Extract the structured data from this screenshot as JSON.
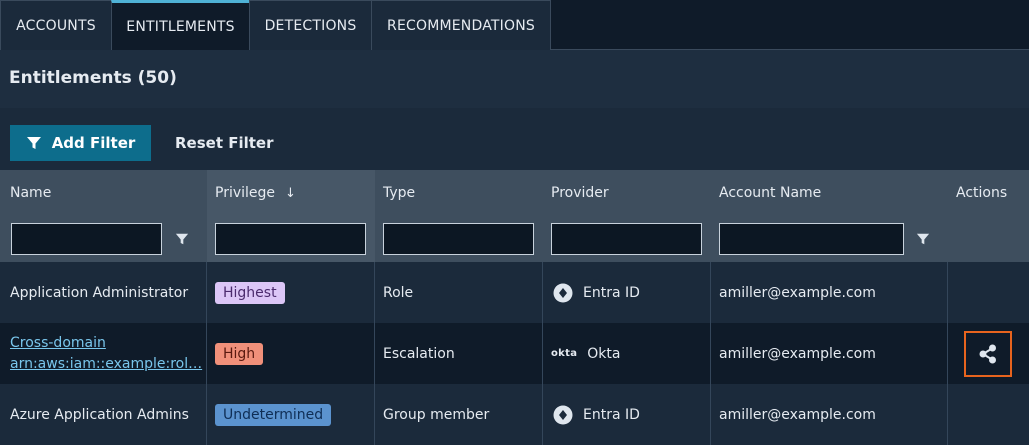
{
  "tabs": [
    {
      "label": "ACCOUNTS",
      "active": false
    },
    {
      "label": "ENTITLEMENTS",
      "active": true
    },
    {
      "label": "DETECTIONS",
      "active": false
    },
    {
      "label": "RECOMMENDATIONS",
      "active": false
    }
  ],
  "page": {
    "title": "Entitlements (50)"
  },
  "filters": {
    "add_label": "Add Filter",
    "reset_label": "Reset Filter"
  },
  "table": {
    "columns": [
      "Name",
      "Privilege",
      "Type",
      "Provider",
      "Account Name",
      "Actions"
    ],
    "sort_arrow": "↓",
    "rows": [
      {
        "name": "Application Administrator",
        "privilege": "Highest",
        "type": "Role",
        "provider": "Entra ID",
        "account": "amiller@example.com"
      },
      {
        "name_line1": "Cross-domain",
        "name_line2": "arn:aws:iam::example:rol…",
        "privilege": "High",
        "type": "Escalation",
        "provider_logo": "okta",
        "provider": "Okta",
        "account": "amiller@example.com"
      },
      {
        "name": "Azure Application Admins",
        "privilege": "Undetermined",
        "type": "Group member",
        "provider": "Entra ID",
        "account": "amiller@example.com"
      }
    ]
  },
  "colors": {
    "accent": "#4fb2d6",
    "primary_button": "#0d6d8c",
    "action_highlight": "#e8641e"
  }
}
